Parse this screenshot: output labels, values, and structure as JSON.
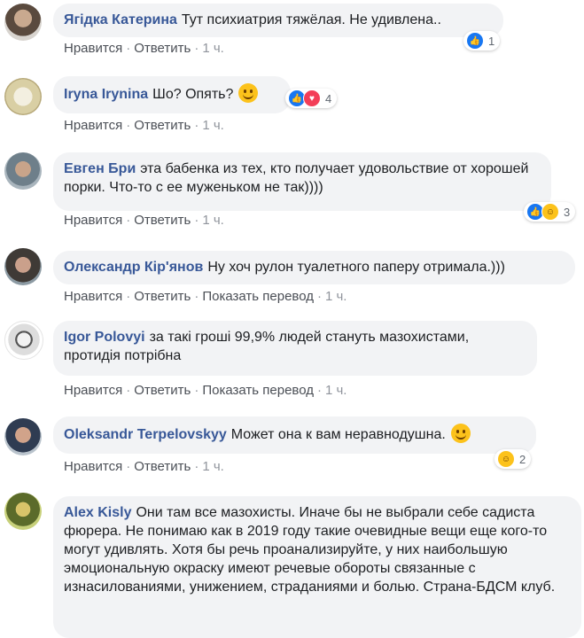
{
  "actions": {
    "like": "Нравится",
    "reply": "Ответить",
    "translate": "Показать перевод",
    "sep": "·"
  },
  "comments": [
    {
      "author": "Ягідка Катерина",
      "text": "Тут психиатрия тяжёлая. Не удивлена..",
      "time": "1 ч.",
      "reactions": [
        "like"
      ],
      "reaction_count": "1"
    },
    {
      "author": "Iryna Irynina",
      "text": "Шо? Опять?",
      "emoji": "smiley",
      "time": "1 ч.",
      "reactions": [
        "like",
        "love"
      ],
      "reaction_count": "4"
    },
    {
      "author": "Евген Бри",
      "text": "эта бабенка из тех, кто получает удовольствие от хорошей порки. Что-то с ее муженьком не так))))",
      "time": "1 ч.",
      "reactions": [
        "like",
        "haha"
      ],
      "reaction_count": "3"
    },
    {
      "author": "Олександр Кір'янов",
      "text": "Ну хоч рулон туалетного паперу отримала.)))",
      "time": "1 ч.",
      "show_translate": true
    },
    {
      "author": "Igor Polovyi",
      "text": "за такі гроші 99,9% людей стануть мазохистами, протидія потрібна",
      "time": "1 ч.",
      "show_translate": true
    },
    {
      "author": "Oleksandr Terpelovskyy",
      "text": "Может она к вам неравнодушна.",
      "emoji": "smiley",
      "time": "1 ч.",
      "reactions": [
        "haha"
      ],
      "reaction_count": "2"
    },
    {
      "author": "Alex Kisly",
      "text": "Они там все мазохисты. Иначе бы не выбрали себе садиста фюрера. Не понимаю как в 2019 году такие очевидные вещи еще кого-то могут удивлять. Хотя бы речь проанализируйте, у них наибольшую эмоциональную окраску имеют речевые обороты связанные с изнасилованиями, унижением, страданиями и болью. Страна-БДСМ клуб."
    }
  ]
}
